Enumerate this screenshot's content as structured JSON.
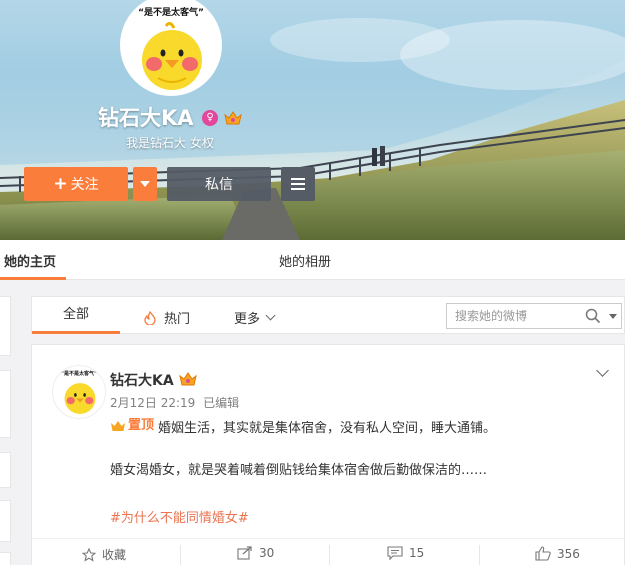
{
  "profile": {
    "avatar_caption": "“是不是太客气”",
    "nickname": "钻石大KA",
    "intro": "我是钻石大 女权",
    "follow_label": "关注",
    "message_label": "私信"
  },
  "tabs": {
    "home": "她的主页",
    "album": "她的相册"
  },
  "filter": {
    "all": "全部",
    "hot": "热门",
    "more": "更多",
    "search_placeholder": "搜索她的微博"
  },
  "post": {
    "author": "钻石大KA",
    "date": "2月12日 22:19",
    "edited": "已编辑",
    "pinned_label": "置顶",
    "text_line1": "婚姻生活，其实就是集体宿舍，没有私人空间，睡大通铺。",
    "text_line2": "婚女渴婚女，就是哭着喊着倒贴钱给集体宿舍做后勤做保洁的……",
    "topic": "#为什么不能同情婚女#",
    "favorite_label": "收藏",
    "repost_count": "30",
    "comment_count": "15",
    "like_count": "356"
  },
  "colors": {
    "accent": "#fa7d3c",
    "topic": "#eb7350",
    "vip": "#e2479b"
  }
}
